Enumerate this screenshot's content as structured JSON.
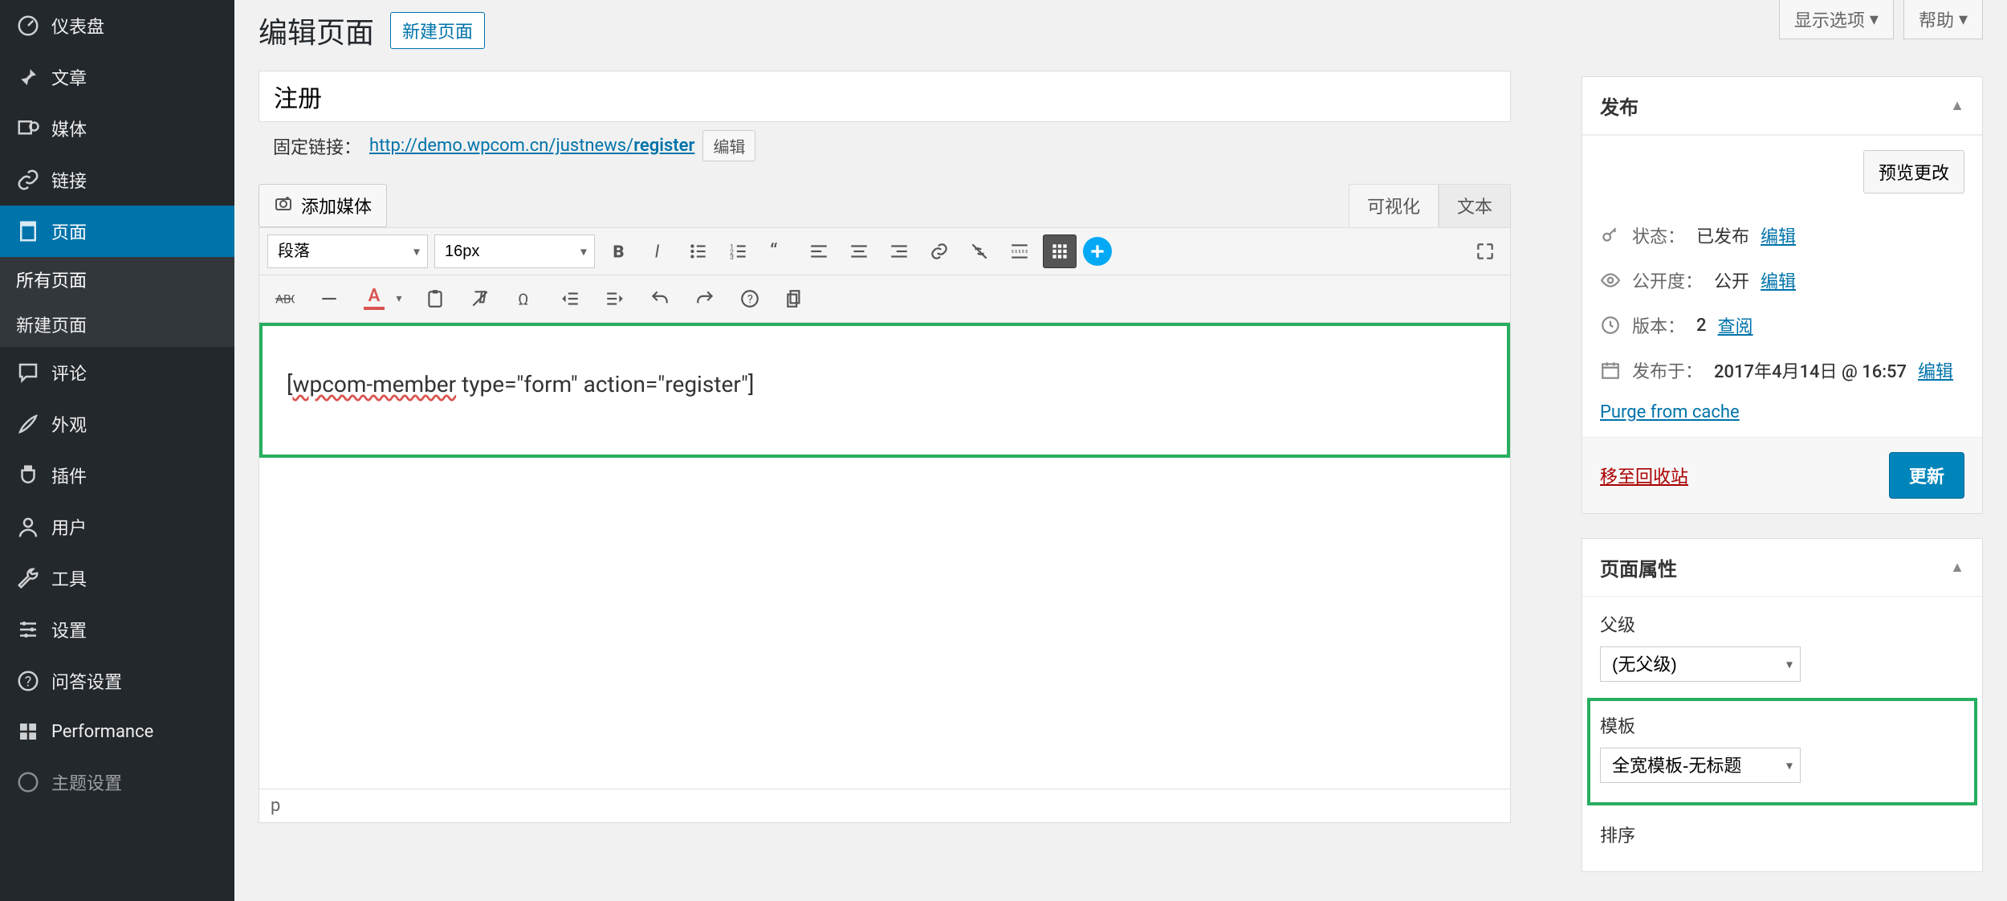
{
  "top": {
    "display_options": "显示选项",
    "help": "帮助"
  },
  "sidebar": {
    "items": [
      {
        "label": "仪表盘",
        "icon": "dashboard"
      },
      {
        "label": "文章",
        "icon": "pin"
      },
      {
        "label": "媒体",
        "icon": "media"
      },
      {
        "label": "链接",
        "icon": "link"
      },
      {
        "label": "页面",
        "icon": "page",
        "active": true
      },
      {
        "label": "评论",
        "icon": "comment"
      },
      {
        "label": "外观",
        "icon": "appearance"
      },
      {
        "label": "插件",
        "icon": "plugin"
      },
      {
        "label": "用户",
        "icon": "user"
      },
      {
        "label": "工具",
        "icon": "tool"
      },
      {
        "label": "设置",
        "icon": "setting"
      },
      {
        "label": "问答设置",
        "icon": "qa"
      },
      {
        "label": "Performance",
        "icon": "performance"
      },
      {
        "label": "主题设置",
        "icon": "theme"
      }
    ],
    "subitems": [
      {
        "label": "所有页面",
        "current": true
      },
      {
        "label": "新建页面",
        "current": false
      }
    ]
  },
  "header": {
    "title": "编辑页面",
    "new_page": "新建页面"
  },
  "title_input": "注册",
  "permalink": {
    "label": "固定链接：",
    "url_base": "http://demo.wpcom.cn/justnews/",
    "slug": "register",
    "edit": "编辑"
  },
  "media": {
    "add_media": "添加媒体"
  },
  "editor_tabs": {
    "visual": "可视化",
    "text": "文本"
  },
  "toolbar": {
    "format": "段落",
    "fontsize": "16px"
  },
  "content": {
    "shortcode_pre": "[",
    "shortcode_mid": "wpcom-member",
    "shortcode_post": " type=\"form\" action=\"register\"]"
  },
  "statusbar": {
    "path": "p"
  },
  "publish": {
    "box_title": "发布",
    "preview": "预览更改",
    "status_label": "状态：",
    "status_value": "已发布",
    "status_edit": "编辑",
    "visibility_label": "公开度：",
    "visibility_value": "公开",
    "visibility_edit": "编辑",
    "revision_label": "版本：",
    "revision_value": "2",
    "revision_browse": "查阅",
    "date_label": "发布于：",
    "date_value": "2017年4月14日 @ 16:57",
    "date_edit": "编辑",
    "purge": "Purge from cache",
    "trash": "移至回收站",
    "update": "更新"
  },
  "attributes": {
    "box_title": "页面属性",
    "parent_label": "父级",
    "parent_value": "(无父级)",
    "template_label": "模板",
    "template_value": "全宽模板-无标题",
    "order_label": "排序"
  }
}
